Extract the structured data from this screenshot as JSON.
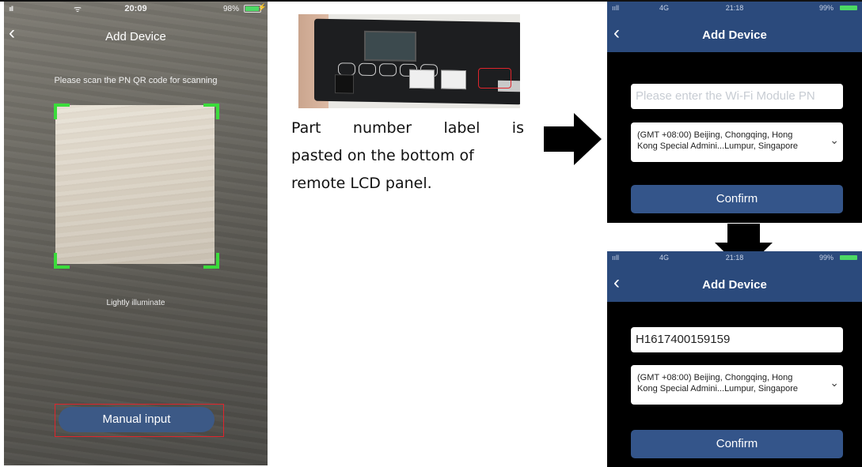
{
  "scanner_screen": {
    "status": {
      "signal": "ııll",
      "wifi": "ᯤ",
      "time": "20:09",
      "battery": "98%",
      "charging": "⚡"
    },
    "back_icon": "‹",
    "title": "Add Device",
    "instruction": "Please scan the PN QR code for scanning",
    "hint": "Lightly illuminate",
    "manual_button": "Manual input"
  },
  "caption": {
    "line1": [
      "Part",
      "number",
      "label",
      "is"
    ],
    "line2": "pasted on the bottom of",
    "line3": "remote LCD panel."
  },
  "entry_screen_empty": {
    "status": {
      "signal": "ııll",
      "network": "4G",
      "time": "21:18",
      "battery": "99%"
    },
    "back_icon": "‹",
    "title": "Add Device",
    "pn_placeholder": "Please enter the Wi-Fi Module PN",
    "timezone_line1": "(GMT +08:00) Beijing, Chongqing, Hong",
    "timezone_line2": "Kong Special Admini...Lumpur, Singapore",
    "confirm": "Confirm"
  },
  "entry_screen_filled": {
    "status": {
      "signal": "ııll",
      "network": "4G",
      "time": "21:18",
      "battery": "99%"
    },
    "back_icon": "‹",
    "title": "Add Device",
    "pn_value": "H1617400159159",
    "timezone_line1": "(GMT +08:00) Beijing, Chongqing, Hong",
    "timezone_line2": "Kong Special Admini...Lumpur, Singapore",
    "confirm": "Confirm"
  },
  "colors": {
    "nav": "#2b4a7c",
    "button": "#34558a",
    "scan_corner": "#3bdc3b",
    "highlight": "#e0242c"
  }
}
